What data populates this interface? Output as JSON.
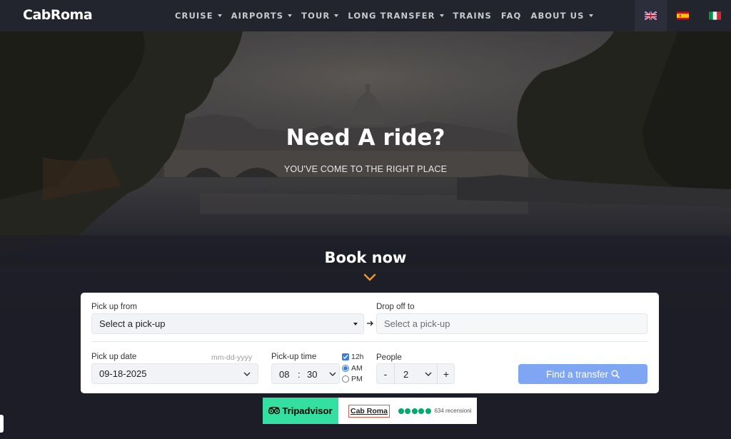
{
  "header": {
    "logo": "CabRoma",
    "menu": [
      {
        "label": "CRUISE",
        "dropdown": true
      },
      {
        "label": "AIRPORTS",
        "dropdown": true
      },
      {
        "label": "TOUR",
        "dropdown": true
      },
      {
        "label": "LONG TRANSFER",
        "dropdown": true
      },
      {
        "label": "TRAINS",
        "dropdown": false
      },
      {
        "label": "FAQ",
        "dropdown": false
      },
      {
        "label": "ABOUT US",
        "dropdown": true
      }
    ],
    "languages": [
      "english-flag",
      "spanish-flag",
      "italian-flag"
    ]
  },
  "hero": {
    "title": "Need A ride?",
    "subtitle": "YOU'VE COME TO THE RIGHT PLACE"
  },
  "booking": {
    "heading": "Book now",
    "pickup_label": "Pick up from",
    "pickup_value": "Select a pick-up",
    "dropoff_label": "Drop off to",
    "dropoff_placeholder": "Select a pick-up",
    "date_label": "Pick up date",
    "date_format_hint": "mm-dd-yyyy",
    "date_value": "09-18-2025",
    "time_label": "Pick-up time",
    "time_hour": "08",
    "time_sep": ":",
    "time_minute": "30",
    "format_12h_label": "12h",
    "am_label": "AM",
    "pm_label": "PM",
    "people_label": "People",
    "people_minus": "-",
    "people_value": "2",
    "people_plus": "+",
    "submit_label": "Find a transfer"
  },
  "tripadvisor": {
    "brand": "Tripadvisor",
    "business": "Cab Roma",
    "rating_dots": 5,
    "reviews": "634 recensioni"
  },
  "colors": {
    "nav_bg": "#21232d",
    "accent_orange": "#e89a2c",
    "button_blue": "#7fa6f2",
    "ta_green": "#34e0a1",
    "ta_dot": "#00aa6c"
  }
}
